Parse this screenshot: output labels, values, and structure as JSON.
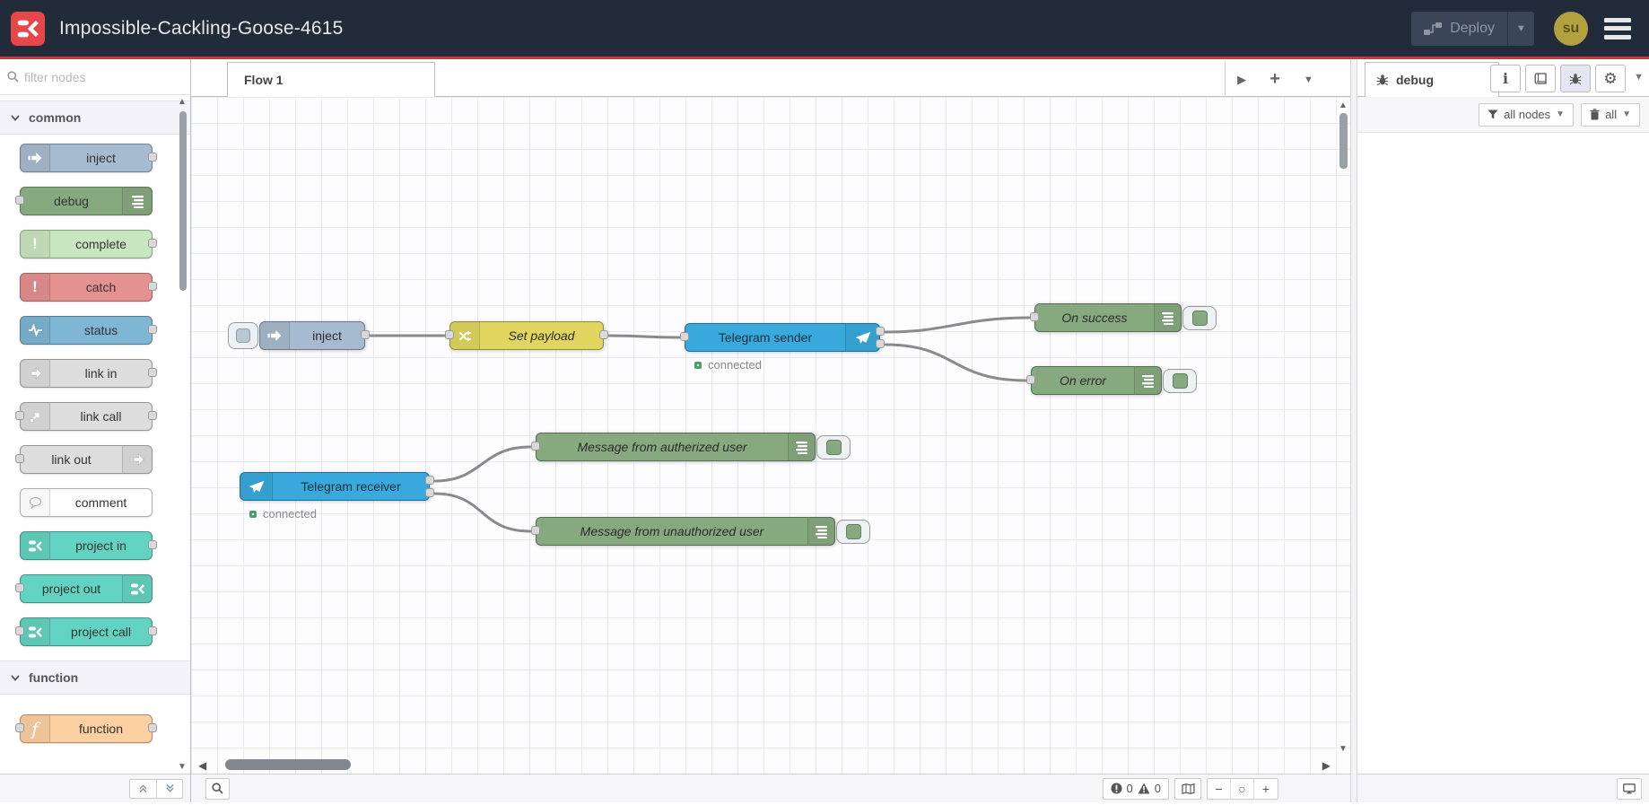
{
  "header": {
    "title": "Impossible-Cackling-Goose-4615",
    "deploy_label": "Deploy",
    "user_initials": "su",
    "colors": {
      "header_bg": "#222b3a",
      "accent_red": "#c23c3c",
      "logo_red": "#e5474b",
      "avatar_gold": "#b3a13f"
    }
  },
  "palette": {
    "filter_placeholder": "filter nodes",
    "categories": [
      {
        "label": "common"
      },
      {
        "label": "function"
      }
    ],
    "nodes": {
      "inject": {
        "label": "inject",
        "color": "#a6bbcf"
      },
      "debug": {
        "label": "debug",
        "color": "#87a980"
      },
      "complete": {
        "label": "complete",
        "color": "#c8e7c0"
      },
      "catch": {
        "label": "catch",
        "color": "#e49191"
      },
      "status": {
        "label": "status",
        "color": "#7eb6d4"
      },
      "link_in": {
        "label": "link in",
        "color": "#dddddd"
      },
      "link_call": {
        "label": "link call",
        "color": "#dddddd"
      },
      "link_out": {
        "label": "link out",
        "color": "#dddddd"
      },
      "comment": {
        "label": "comment",
        "color": "#ffffff"
      },
      "project_in": {
        "label": "project in",
        "color": "#63d3c1"
      },
      "project_out": {
        "label": "project out",
        "color": "#63d3c1"
      },
      "project_call": {
        "label": "project call",
        "color": "#63d3c1"
      },
      "function": {
        "label": "function",
        "color": "#fdd0a2"
      }
    }
  },
  "workspace": {
    "tab": "Flow 1",
    "flow": {
      "inject": {
        "label": "inject",
        "color": "#a6bbcf"
      },
      "set_payload": {
        "label": "Set payload",
        "color": "#e0d65f"
      },
      "sender": {
        "label": "Telegram sender",
        "color": "#39a9dd",
        "status": "connected"
      },
      "on_success": {
        "label": "On success",
        "color": "#87a980"
      },
      "on_error": {
        "label": "On error",
        "color": "#87a980"
      },
      "receiver": {
        "label": "Telegram receiver",
        "color": "#39a9dd",
        "status": "connected"
      },
      "msg_auth": {
        "label": "Message from autherized user",
        "color": "#87a980"
      },
      "msg_unauth": {
        "label": "Message from unauthorized user",
        "color": "#87a980"
      }
    },
    "status_green": "#4c9f68",
    "footer": {
      "error_count": "0",
      "warning_count": "0"
    }
  },
  "sidebar": {
    "tab_label": "debug",
    "filter_label": "all nodes",
    "clear_label": "all"
  }
}
